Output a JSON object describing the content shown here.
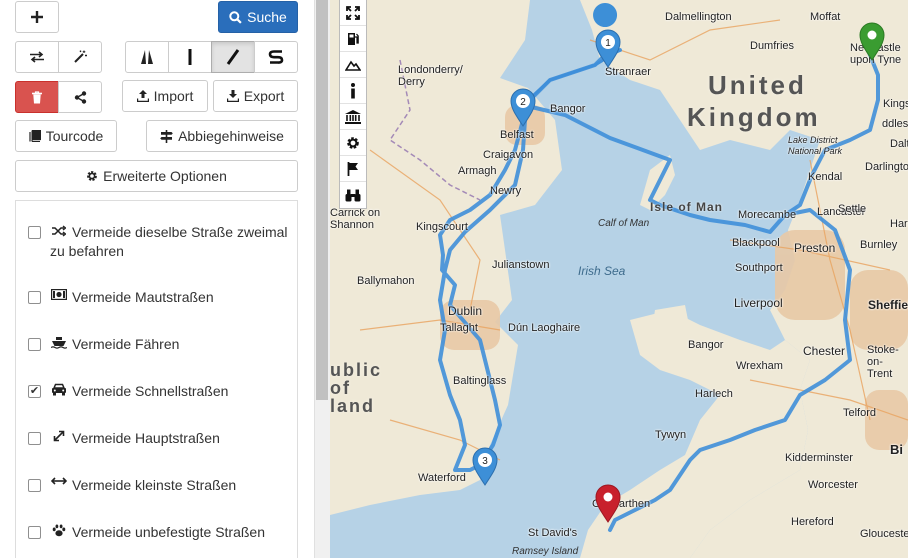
{
  "panel": {
    "search_label": "Suche",
    "import_label": "Import",
    "export_label": "Export",
    "tourcode_label": "Tourcode",
    "directions_label": "Abbiegehinweise",
    "advanced_label": "Erweiterte Optionen",
    "options": [
      {
        "label": "Vermeide dieselbe Straße zweimal zu befahren",
        "icon": "shuffle-icon",
        "checked": false
      },
      {
        "label": "Vermeide Mautstraßen",
        "icon": "money-icon",
        "checked": false
      },
      {
        "label": "Vermeide Fähren",
        "icon": "ship-icon",
        "checked": false
      },
      {
        "label": "Vermeide Schnellstraßen",
        "icon": "car-icon",
        "checked": true
      },
      {
        "label": "Vermeide Hauptstraßen",
        "icon": "expand-arrows-icon",
        "checked": false
      },
      {
        "label": "Vermeide kleinste Straßen",
        "icon": "horizontal-arrows-icon",
        "checked": false
      },
      {
        "label": "Vermeide unbefestigte Straßen",
        "icon": "paw-icon",
        "checked": false
      }
    ]
  },
  "map": {
    "labels": {
      "country_line1": "United",
      "country_line2": "Kingdom",
      "republic_1": "ublic",
      "republic_2": "of",
      "republic_3": "land",
      "isle_of_man": "Isle of Man",
      "irish_sea": "Irish Sea",
      "calf_of_man": "Calf of Man",
      "ramsey_island": "Ramsey Island",
      "dalmellington": "Dalmellington",
      "moffat": "Moffat",
      "dumfries": "Dumfries",
      "newcastle": "Newcastle upon Tyne",
      "stranraer": "Stranraer",
      "londonderry": "Londonderry/ Derry",
      "bangor_ni": "Bangor",
      "belfast": "Belfast",
      "craigavon": "Craigavon",
      "armagh": "Armagh",
      "newry": "Newry",
      "carrick": "Carrick on Shannon",
      "kingscourt": "Kingscourt",
      "julianstown": "Julianstown",
      "ballymahon": "Ballymahon",
      "dublin": "Dublin",
      "tallaght": "Tallaght",
      "dun_laoghaire": "Dún Laoghaire",
      "baltinglass": "Baltinglass",
      "waterford": "Waterford",
      "carmarthen": "Carmarthen",
      "st_davids": "St David's",
      "tywyn": "Tywyn",
      "harlech": "Harlech",
      "bangor_wales": "Bangor",
      "wrexham": "Wrexham",
      "chester": "Chester",
      "liverpool": "Liverpool",
      "southport": "Southport",
      "blackpool": "Blackpool",
      "preston": "Preston",
      "lancaster": "Lancaster",
      "morecambe": "Morecambe",
      "burnley": "Burnley",
      "sheffield": "Sheffiel",
      "stoke": "Stoke-on- Trent",
      "telford": "Telford",
      "kidderminster": "Kidderminster",
      "worcester": "Worcester",
      "hereford": "Hereford",
      "gloucester": "Glouceste",
      "birmingham": "Bi",
      "darlington": "Darlington",
      "lake_district": "Lake District National Park",
      "kendal": "Kendal",
      "settle": "Settle",
      "harrogate": "Harro",
      "middlesbrough": "ddles",
      "dalt": "Dalt",
      "kingst": "Kingst"
    },
    "waypoints": [
      "1",
      "2",
      "3"
    ],
    "route_color": "#3f8fd9",
    "start_marker_color": "#3a9c31",
    "end_marker_color": "#c8202c",
    "waypoint_color": "#3d8fd7",
    "land_color": "#efe9d7",
    "sea_color": "#b6d2e6"
  }
}
